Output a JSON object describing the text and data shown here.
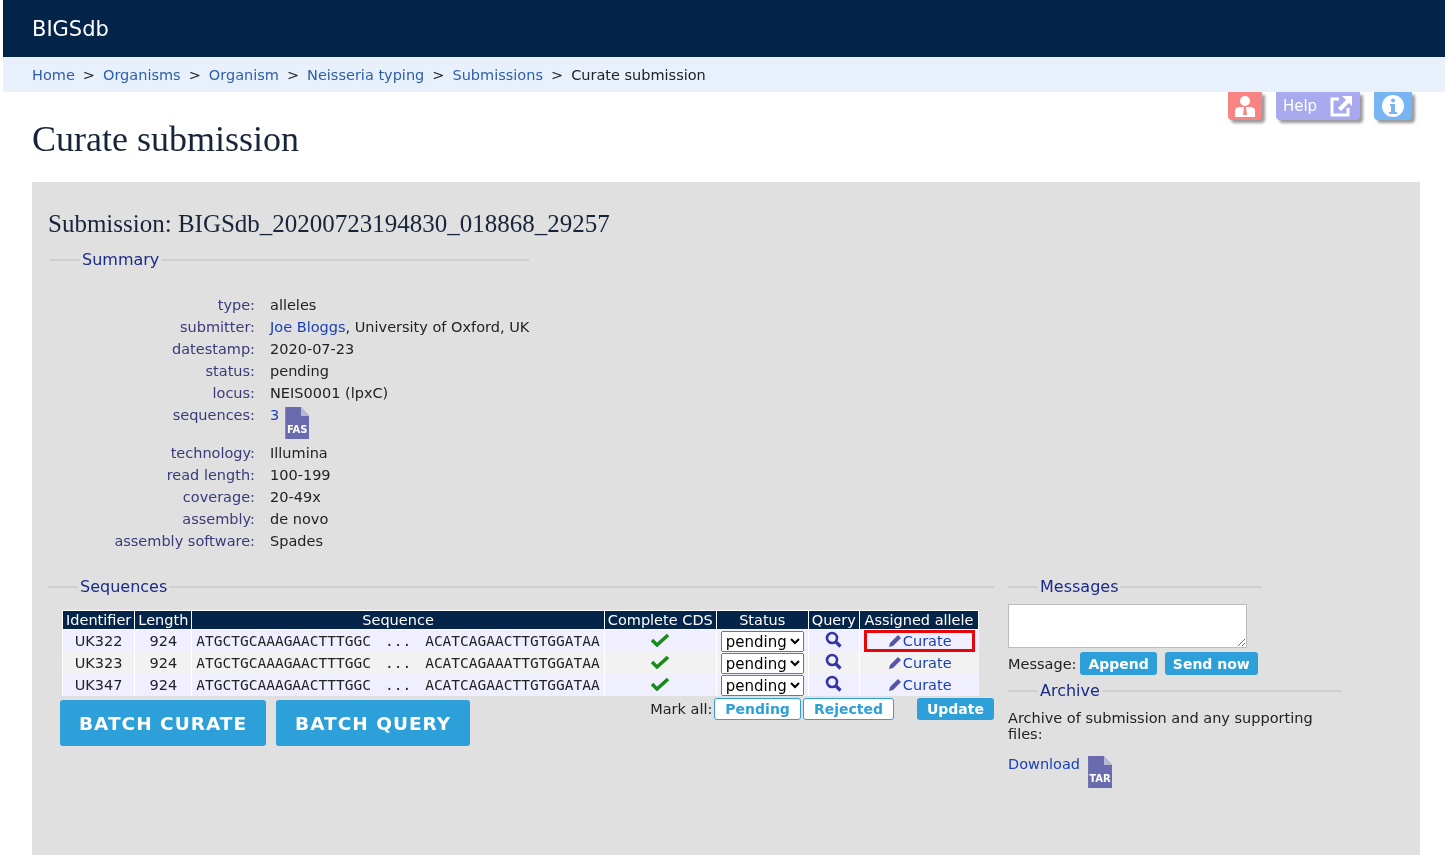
{
  "site": {
    "title": "BIGSdb"
  },
  "breadcrumbs": {
    "links": [
      {
        "label": "Home",
        "separator": ">"
      },
      {
        "label": "Organisms",
        "separator": ">"
      },
      {
        "label": "Organism",
        "separator": ">"
      },
      {
        "label": "Neisseria typing",
        "separator": ">"
      },
      {
        "label": "Submissions",
        "separator": ">"
      }
    ],
    "current": "Curate submission"
  },
  "toolbar": {
    "help": "Help"
  },
  "page_title": "Curate submission",
  "submission_title": "Submission: BIGSdb_20200723194830_018868_29257",
  "summary": {
    "legend": "Summary",
    "fields": [
      {
        "label": "type:",
        "kind": "text",
        "value": "alleles"
      },
      {
        "label": "submitter:",
        "kind": "person",
        "link": "Joe Bloggs",
        "value": ", University of Oxford, UK"
      },
      {
        "label": "datestamp:",
        "kind": "text",
        "value": "2020-07-23"
      },
      {
        "label": "status:",
        "kind": "text",
        "value": "pending"
      },
      {
        "label": "locus:",
        "kind": "text",
        "value": "NEIS0001 (lpxC)"
      },
      {
        "label": "sequences:",
        "kind": "file",
        "link": "3",
        "file_type": "FAS"
      },
      {
        "label": "technology:",
        "kind": "text",
        "value": "Illumina"
      },
      {
        "label": "read length:",
        "kind": "text",
        "value": "100-199"
      },
      {
        "label": "coverage:",
        "kind": "text",
        "value": "20-49x"
      },
      {
        "label": "assembly:",
        "kind": "text",
        "value": "de novo"
      },
      {
        "label": "assembly software:",
        "kind": "text",
        "value": "Spades"
      }
    ]
  },
  "sequences": {
    "legend": "Sequences",
    "columns": [
      "Identifier",
      "Length",
      "Sequence",
      "Complete CDS",
      "Status",
      "Query",
      "Assigned allele"
    ],
    "rows": [
      {
        "identifier": "UK322",
        "length": "924",
        "sequence_start": "ATGCTGCAAAGAACTTTGGC",
        "ellipsis": "...",
        "sequence_end": "ACATCAGAACTTGTGGATAA",
        "complete": true,
        "status": "pending",
        "action": "Curate",
        "highlighted": true
      },
      {
        "identifier": "UK323",
        "length": "924",
        "sequence_start": "ATGCTGCAAAGAACTTTGGC",
        "ellipsis": "...",
        "sequence_end": "ACATCAGAAATTGTGGATAA",
        "complete": true,
        "status": "pending",
        "action": "Curate",
        "highlighted": false
      },
      {
        "identifier": "UK347",
        "length": "924",
        "sequence_start": "ATGCTGCAAAGAACTTTGGC",
        "ellipsis": "...",
        "sequence_end": "ACATCAGAACTTGTGGATAA",
        "complete": true,
        "status": "pending",
        "action": "Curate",
        "highlighted": false
      }
    ],
    "mark_all_label": "Mark all:",
    "mark_all_buttons": [
      "Pending",
      "Rejected"
    ],
    "update": "Update",
    "batch_buttons": [
      "BATCH CURATE",
      "BATCH QUERY"
    ]
  },
  "messages": {
    "legend": "Messages",
    "label": "Message:",
    "buttons": [
      "Append",
      "Send now"
    ]
  },
  "archive": {
    "legend": "Archive",
    "text": "Archive of submission and any supporting files:",
    "link": "Download",
    "file_type": "TAR"
  }
}
